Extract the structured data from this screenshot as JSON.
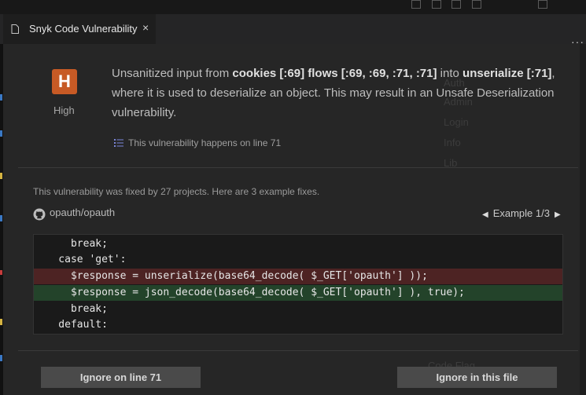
{
  "tab": {
    "title": "Snyk Code Vulnerability",
    "close_glyph": "×",
    "more_glyph": "···"
  },
  "issue": {
    "severity_letter": "H",
    "severity_label": "High",
    "severity_color": "#c75a25",
    "summary_parts": {
      "p1": "Unsanitized input from ",
      "b1": "cookies [:69] flows [:69, :69, :71, :71]",
      "p2": " into ",
      "b2": "unserialize [:71]",
      "p3": ", where it is used to deserialize an object. This may result in an Unsafe Deserialization vulnerability."
    },
    "line_link": "This vulnerability happens on line 71"
  },
  "fixes": {
    "info": "This vulnerability was fixed by 27 projects. Here are 3 example fixes.",
    "repo": "opauth/opauth",
    "example_label": "Example 1/3",
    "code_lines": [
      {
        "text": "      break;",
        "kind": "normal"
      },
      {
        "text": "    case 'get':",
        "kind": "normal"
      },
      {
        "text": "      $response = unserialize(base64_decode( $_GET['opauth'] ));",
        "kind": "removed"
      },
      {
        "text": "      $response = json_decode(base64_decode( $_GET['opauth'] ), true);",
        "kind": "added"
      },
      {
        "text": "      break;",
        "kind": "normal"
      },
      {
        "text": "    default:",
        "kind": "normal"
      }
    ]
  },
  "actions": {
    "ignore_line": "Ignore on line 71",
    "ignore_file": "Ignore in this file"
  }
}
